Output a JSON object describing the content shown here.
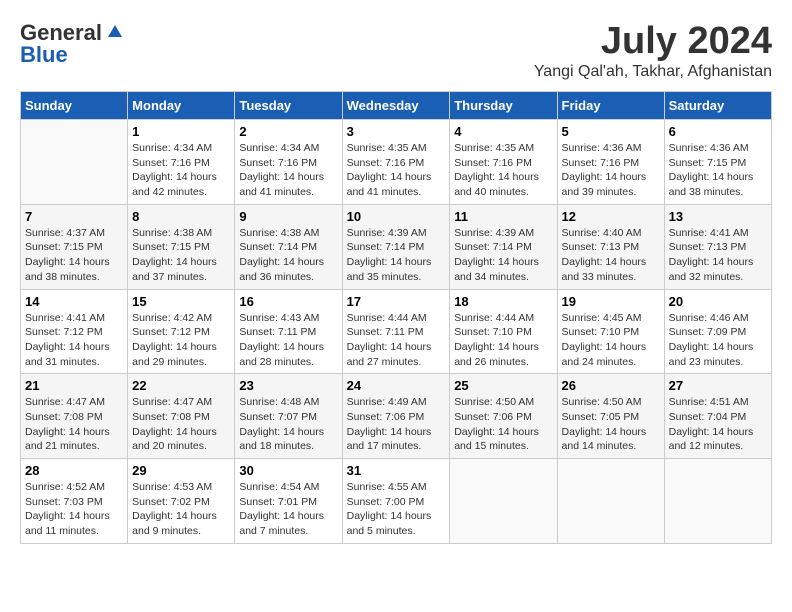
{
  "header": {
    "logo_general": "General",
    "logo_blue": "Blue",
    "month_title": "July 2024",
    "location": "Yangi Qal'ah, Takhar, Afghanistan"
  },
  "days_of_week": [
    "Sunday",
    "Monday",
    "Tuesday",
    "Wednesday",
    "Thursday",
    "Friday",
    "Saturday"
  ],
  "weeks": [
    [
      {
        "day": "",
        "sunrise": "",
        "sunset": "",
        "daylight": ""
      },
      {
        "day": "1",
        "sunrise": "Sunrise: 4:34 AM",
        "sunset": "Sunset: 7:16 PM",
        "daylight": "Daylight: 14 hours and 42 minutes."
      },
      {
        "day": "2",
        "sunrise": "Sunrise: 4:34 AM",
        "sunset": "Sunset: 7:16 PM",
        "daylight": "Daylight: 14 hours and 41 minutes."
      },
      {
        "day": "3",
        "sunrise": "Sunrise: 4:35 AM",
        "sunset": "Sunset: 7:16 PM",
        "daylight": "Daylight: 14 hours and 41 minutes."
      },
      {
        "day": "4",
        "sunrise": "Sunrise: 4:35 AM",
        "sunset": "Sunset: 7:16 PM",
        "daylight": "Daylight: 14 hours and 40 minutes."
      },
      {
        "day": "5",
        "sunrise": "Sunrise: 4:36 AM",
        "sunset": "Sunset: 7:16 PM",
        "daylight": "Daylight: 14 hours and 39 minutes."
      },
      {
        "day": "6",
        "sunrise": "Sunrise: 4:36 AM",
        "sunset": "Sunset: 7:15 PM",
        "daylight": "Daylight: 14 hours and 38 minutes."
      }
    ],
    [
      {
        "day": "7",
        "sunrise": "Sunrise: 4:37 AM",
        "sunset": "Sunset: 7:15 PM",
        "daylight": "Daylight: 14 hours and 38 minutes."
      },
      {
        "day": "8",
        "sunrise": "Sunrise: 4:38 AM",
        "sunset": "Sunset: 7:15 PM",
        "daylight": "Daylight: 14 hours and 37 minutes."
      },
      {
        "day": "9",
        "sunrise": "Sunrise: 4:38 AM",
        "sunset": "Sunset: 7:14 PM",
        "daylight": "Daylight: 14 hours and 36 minutes."
      },
      {
        "day": "10",
        "sunrise": "Sunrise: 4:39 AM",
        "sunset": "Sunset: 7:14 PM",
        "daylight": "Daylight: 14 hours and 35 minutes."
      },
      {
        "day": "11",
        "sunrise": "Sunrise: 4:39 AM",
        "sunset": "Sunset: 7:14 PM",
        "daylight": "Daylight: 14 hours and 34 minutes."
      },
      {
        "day": "12",
        "sunrise": "Sunrise: 4:40 AM",
        "sunset": "Sunset: 7:13 PM",
        "daylight": "Daylight: 14 hours and 33 minutes."
      },
      {
        "day": "13",
        "sunrise": "Sunrise: 4:41 AM",
        "sunset": "Sunset: 7:13 PM",
        "daylight": "Daylight: 14 hours and 32 minutes."
      }
    ],
    [
      {
        "day": "14",
        "sunrise": "Sunrise: 4:41 AM",
        "sunset": "Sunset: 7:12 PM",
        "daylight": "Daylight: 14 hours and 31 minutes."
      },
      {
        "day": "15",
        "sunrise": "Sunrise: 4:42 AM",
        "sunset": "Sunset: 7:12 PM",
        "daylight": "Daylight: 14 hours and 29 minutes."
      },
      {
        "day": "16",
        "sunrise": "Sunrise: 4:43 AM",
        "sunset": "Sunset: 7:11 PM",
        "daylight": "Daylight: 14 hours and 28 minutes."
      },
      {
        "day": "17",
        "sunrise": "Sunrise: 4:44 AM",
        "sunset": "Sunset: 7:11 PM",
        "daylight": "Daylight: 14 hours and 27 minutes."
      },
      {
        "day": "18",
        "sunrise": "Sunrise: 4:44 AM",
        "sunset": "Sunset: 7:10 PM",
        "daylight": "Daylight: 14 hours and 26 minutes."
      },
      {
        "day": "19",
        "sunrise": "Sunrise: 4:45 AM",
        "sunset": "Sunset: 7:10 PM",
        "daylight": "Daylight: 14 hours and 24 minutes."
      },
      {
        "day": "20",
        "sunrise": "Sunrise: 4:46 AM",
        "sunset": "Sunset: 7:09 PM",
        "daylight": "Daylight: 14 hours and 23 minutes."
      }
    ],
    [
      {
        "day": "21",
        "sunrise": "Sunrise: 4:47 AM",
        "sunset": "Sunset: 7:08 PM",
        "daylight": "Daylight: 14 hours and 21 minutes."
      },
      {
        "day": "22",
        "sunrise": "Sunrise: 4:47 AM",
        "sunset": "Sunset: 7:08 PM",
        "daylight": "Daylight: 14 hours and 20 minutes."
      },
      {
        "day": "23",
        "sunrise": "Sunrise: 4:48 AM",
        "sunset": "Sunset: 7:07 PM",
        "daylight": "Daylight: 14 hours and 18 minutes."
      },
      {
        "day": "24",
        "sunrise": "Sunrise: 4:49 AM",
        "sunset": "Sunset: 7:06 PM",
        "daylight": "Daylight: 14 hours and 17 minutes."
      },
      {
        "day": "25",
        "sunrise": "Sunrise: 4:50 AM",
        "sunset": "Sunset: 7:06 PM",
        "daylight": "Daylight: 14 hours and 15 minutes."
      },
      {
        "day": "26",
        "sunrise": "Sunrise: 4:50 AM",
        "sunset": "Sunset: 7:05 PM",
        "daylight": "Daylight: 14 hours and 14 minutes."
      },
      {
        "day": "27",
        "sunrise": "Sunrise: 4:51 AM",
        "sunset": "Sunset: 7:04 PM",
        "daylight": "Daylight: 14 hours and 12 minutes."
      }
    ],
    [
      {
        "day": "28",
        "sunrise": "Sunrise: 4:52 AM",
        "sunset": "Sunset: 7:03 PM",
        "daylight": "Daylight: 14 hours and 11 minutes."
      },
      {
        "day": "29",
        "sunrise": "Sunrise: 4:53 AM",
        "sunset": "Sunset: 7:02 PM",
        "daylight": "Daylight: 14 hours and 9 minutes."
      },
      {
        "day": "30",
        "sunrise": "Sunrise: 4:54 AM",
        "sunset": "Sunset: 7:01 PM",
        "daylight": "Daylight: 14 hours and 7 minutes."
      },
      {
        "day": "31",
        "sunrise": "Sunrise: 4:55 AM",
        "sunset": "Sunset: 7:00 PM",
        "daylight": "Daylight: 14 hours and 5 minutes."
      },
      {
        "day": "",
        "sunrise": "",
        "sunset": "",
        "daylight": ""
      },
      {
        "day": "",
        "sunrise": "",
        "sunset": "",
        "daylight": ""
      },
      {
        "day": "",
        "sunrise": "",
        "sunset": "",
        "daylight": ""
      }
    ]
  ]
}
